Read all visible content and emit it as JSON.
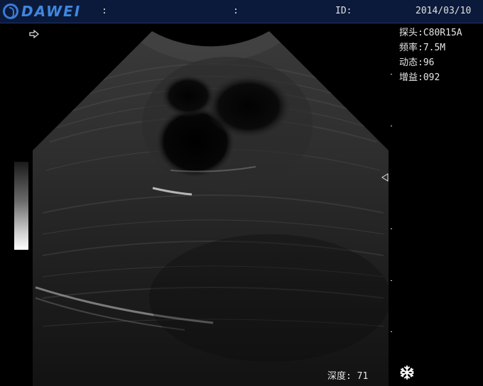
{
  "header": {
    "brand": "DAWEI",
    "separator_1": ":",
    "separator_2": ":",
    "id_label": "ID:",
    "date": "2014/03/10"
  },
  "params": {
    "probe": "探头:C80R15A",
    "frequency": "频率:7.5M",
    "dynamic": "动态:96",
    "gain": "增益:092"
  },
  "footer": {
    "depth": "深度: 71"
  },
  "icons": {
    "logo": "dawei-logo-icon",
    "pointer": "arrow-right-icon",
    "focus": "focus-marker-icon",
    "freeze": "snowflake-freeze-icon"
  },
  "colors": {
    "header_bg": "#0b1a3a",
    "brand_blue": "#3f86e0",
    "text": "#e6e6e6"
  }
}
